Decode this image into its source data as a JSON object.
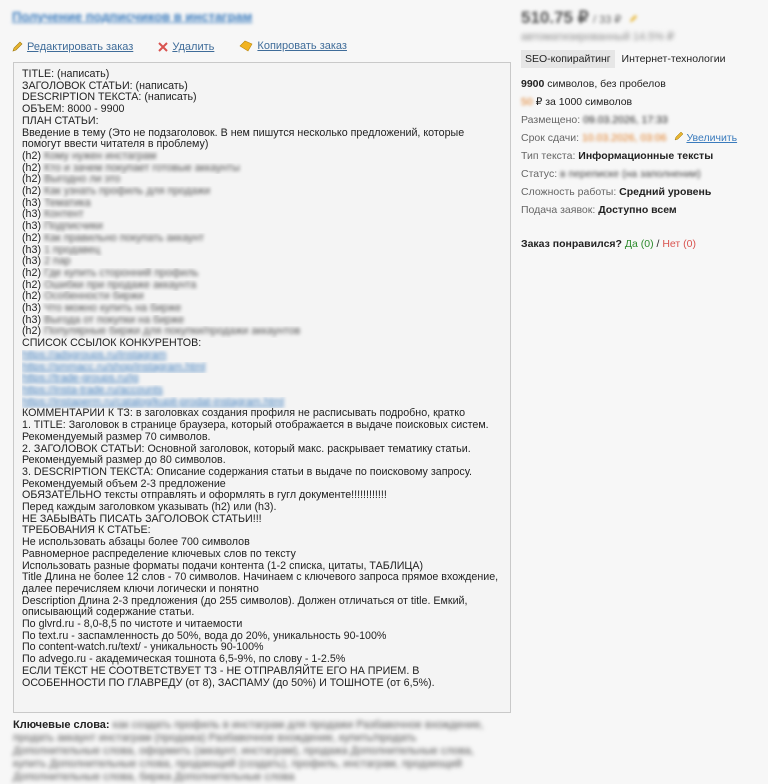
{
  "order": {
    "title": "Получение подписчиков в инстаграм",
    "price": "510.75 ₽",
    "price_unit": "/ 33 ₽",
    "price_sub": "автоматизированный 14.5% ₽"
  },
  "actions": {
    "edit": "Редактировать заказ",
    "delete": "Удалить",
    "copy": "Копировать заказ"
  },
  "description": {
    "title": "TITLE: (написать)",
    "heading": "ЗАГОЛОВОК СТАТЬИ: (написать)",
    "desc": "DESCRIPTION ТЕКСТА: (написать)",
    "volume": "ОБЪЁМ: 8000 - 9900",
    "plan": "ПЛАН СТАТЬИ:",
    "intro": "Введение в тему (Это не подзаголовок. В нем пишутся несколько предложений, которые помогут ввести читателя в проблему)",
    "plan_items": [
      {
        "tag": "(h2)",
        "text": "Кому нужен инстаграм"
      },
      {
        "tag": "(h2)",
        "text": "Кто и зачем покупает готовые аккаунты"
      },
      {
        "tag": "(h2)",
        "text": "Выгодно ли это"
      },
      {
        "tag": "(h2)",
        "text": "Как узнать профиль для продажи"
      },
      {
        "tag": "(h3)",
        "text": "Тематика"
      },
      {
        "tag": "(h3)",
        "text": "Контент"
      },
      {
        "tag": "(h3)",
        "text": "Подписчики"
      },
      {
        "tag": "(h2)",
        "text": "Как правильно покупать аккаунт"
      },
      {
        "tag": "(h3)",
        "text": "1 продавец"
      },
      {
        "tag": "(h3)",
        "text": "2 пар"
      },
      {
        "tag": "(h2)",
        "text": "Где купить сторонний профиль"
      },
      {
        "tag": "(h2)",
        "text": "Ошибки при продаже аккаунта"
      },
      {
        "tag": "(h2)",
        "text": "Особенности биржи"
      },
      {
        "tag": "(h3)",
        "text": "Что можно купить на бирже"
      },
      {
        "tag": "(h3)",
        "text": "Выгода от покупки на бирже"
      },
      {
        "tag": "(h2)",
        "text": "Популярные биржи для покупки/продажи аккаунтов"
      }
    ],
    "competitors_label": "СПИСОК ССЫЛОК КОНКУРЕНТОВ:",
    "links": [
      "https://adsgroups.ru/instagram",
      "https://smmacc.ru/shop/instagram.html",
      "https://trade-groups.ru/ig",
      "https://insta-trade.ru/accounts",
      "https://instaperm.ru/catalog/kupit-prodat-instagram.html"
    ],
    "lines": [
      "КОММЕНТАРИЙ К ТЗ: в заголовках создания профиля не расписывать подробно, кратко",
      "1. TITLE: Заголовок в странице браузера, который отображается в выдаче поисковых систем.",
      "Рекомендуемый размер 70 символов.",
      "2. ЗАГОЛОВОК СТАТЬИ: Основной заголовок, который макс. раскрывает тематику статьи.",
      "Рекомендуемый размер до 80 символов.",
      "3. DESCRIPTION ТЕКСТА: Описание содержания статьи в выдаче по поисковому запросу.",
      "Рекомендуемый объем 2-3 предложение",
      "ОБЯЗАТЕЛЬНО тексты отправлять и оформлять в гугл документе!!!!!!!!!!!!",
      "Перед каждым заголовком указывать (h2) или (h3).",
      "НЕ ЗАБЫВАТЬ ПИСАТЬ ЗАГОЛОВОК СТАТЬИ!!!",
      "ТРЕБОВАНИЯ К СТАТЬЕ:",
      "Не использовать абзацы более 700 символов",
      "Равномерное распределение ключевых слов по тексту",
      "Использовать разные форматы подачи контента (1-2 списка, цитаты, ТАБЛИЦА)"
    ],
    "title_len": "Title Длина не более 12 слов - 70 символов. Начинаем с ключевого запроса прямое вхождение, далее перечисляем ключи логически и понятно",
    "desc_len": "Description Длина 2-3 предложения (до 255 символов). Должен отличаться от title. Емкий, описывающий содержание статьи.",
    "lines2": [
      "По glvrd.ru - 8,0-8,5 по чистоте и читаемости",
      "По text.ru - заспамленность до 50%, вода до 20%, уникальность 90-100%",
      "По content-watch.ru/text/ - уникальность 90-100%",
      "По advego.ru - академическая тошнота 6,5-9%, по слову - 1-2.5%"
    ],
    "warning": "ЕСЛИ ТЕКСТ НЕ СООТВЕТСТВУЕТ ТЗ - НЕ ОТПРАВЛЯЙТЕ ЕГО НА ПРИЕМ. В ОСОБЕННОСТИ ПО ГЛАВРЕДУ (от 8), ЗАСПАМУ (до 50%) И ТОШНОТЕ (от 6,5%)."
  },
  "keywords": {
    "label": "Ключевые слова:",
    "text": "как создать профиль в инстаграм для продажи Разбавочное вхождение, продать аккаунт инстаграм (продажа) Разбавочное вхождение, купить/продать Дополнительные слова, оформить (аккаунт, инстаграм), продажа Дополнительные слова, купить Дополнительные слова, продающий (создать), профиль, инстаграм, продающий Дополнительные слова, биржа Дополнительные слова"
  },
  "sidebar": {
    "category_tag": "SEO-копирайтинг",
    "category_sub": "Интернет-технологии",
    "chars_value": "9900",
    "chars_text": "символов, без пробелов",
    "rate_value": "50",
    "rate_text": "₽ за 1000 символов",
    "posted_label": "Размещено:",
    "posted_value": "09.03.2026, 17:33",
    "deadline_label": "Срок сдачи:",
    "deadline_value": "10.03.2026, 03:06",
    "increase_label": "Увеличить",
    "type_label": "Тип текста:",
    "type_value": "Информационные тексты",
    "status_label": "Статус:",
    "status_value": "в переписке (на заполнении)",
    "difficulty_label": "Сложность работы:",
    "difficulty_value": "Средний уровень",
    "applications_label": "Подача заявок:",
    "applications_value": "Доступно всем",
    "liked_label": "Заказ понравился?",
    "yes_label": "Да (0)",
    "separator": "/",
    "no_label": "Нет (0)"
  },
  "colors": {
    "link": "#3a7bbd",
    "accent_orange": "#e07a1f",
    "yes_green": "#2b8a2b",
    "no_red": "#d9534f"
  }
}
